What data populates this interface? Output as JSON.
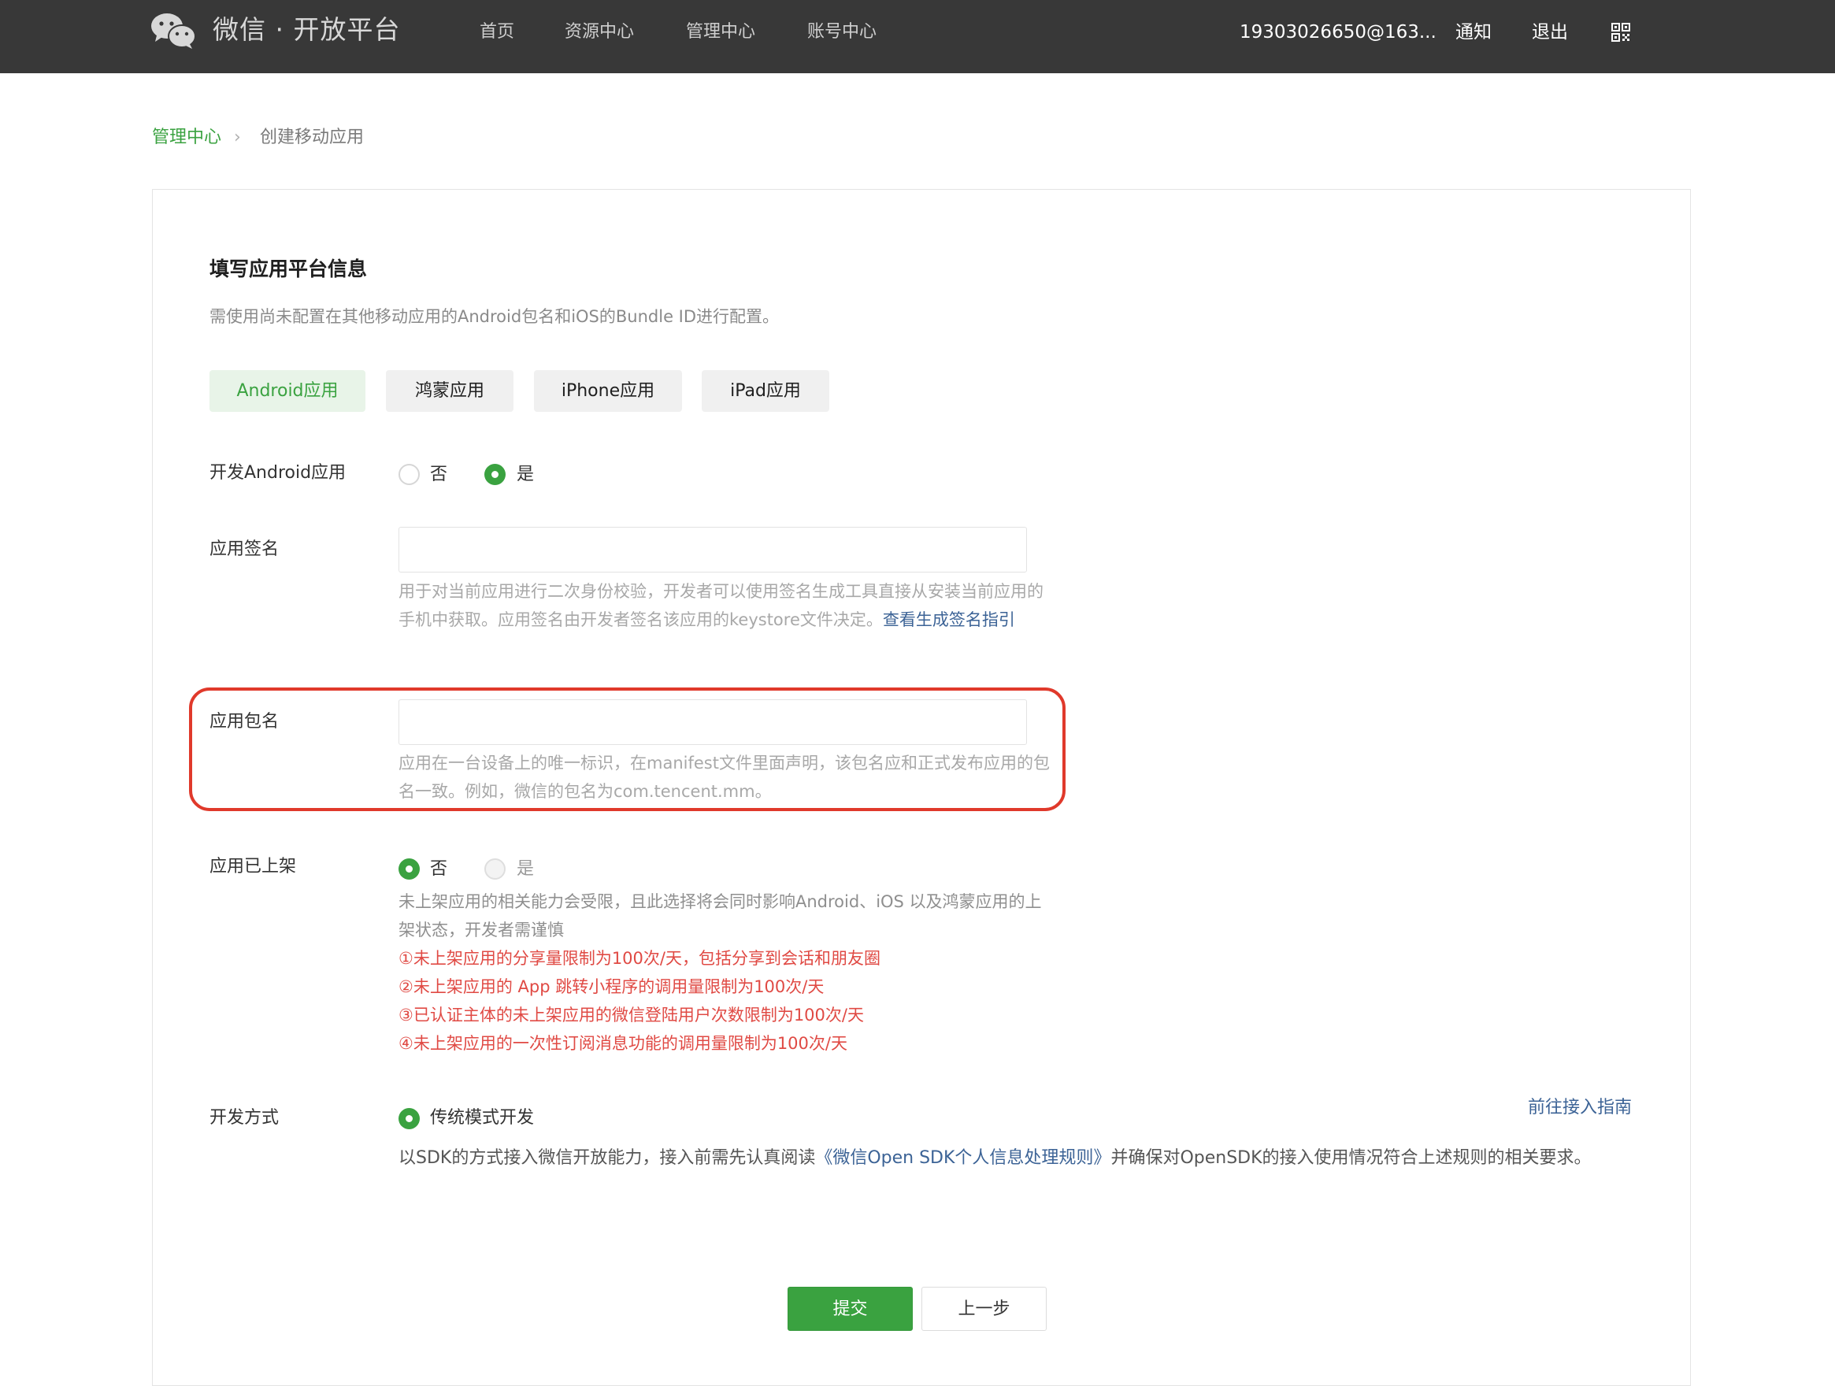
{
  "header": {
    "brand": "微信 · 开放平台",
    "nav": [
      {
        "label": "首页"
      },
      {
        "label": "资源中心"
      },
      {
        "label": "管理中心"
      },
      {
        "label": "账号中心"
      }
    ],
    "account": "19303026650@163...",
    "notify_label": "通知",
    "logout_label": "退出",
    "qr_icon": "qr-code-icon"
  },
  "breadcrumb": {
    "parent": "管理中心",
    "separator": "›",
    "current": "创建移动应用"
  },
  "form": {
    "title": "填写应用平台信息",
    "description": "需使用尚未配置在其他移动应用的Android包名和iOS的Bundle ID进行配置。",
    "tabs": [
      {
        "label": "Android应用",
        "active": true
      },
      {
        "label": "鸿蒙应用",
        "active": false
      },
      {
        "label": "iPhone应用",
        "active": false
      },
      {
        "label": "iPad应用",
        "active": false
      }
    ],
    "develop_android": {
      "label": "开发Android应用",
      "options": [
        "否",
        "是"
      ],
      "selected": "是"
    },
    "app_signature": {
      "label": "应用签名",
      "value": "",
      "help": "用于对当前应用进行二次身份校验，开发者可以使用签名生成工具直接从安装当前应用的手机中获取。应用签名由开发者签名该应用的keystore文件决定。",
      "help_link": "查看生成签名指引"
    },
    "package_name": {
      "label": "应用包名",
      "value": "",
      "help": "应用在一台设备上的唯一标识，在manifest文件里面声明，该包名应和正式发布应用的包名一致。例如，微信的包名为com.tencent.mm。"
    },
    "published": {
      "label": "应用已上架",
      "options": [
        "否",
        "是"
      ],
      "selected": "否",
      "help": "未上架应用的相关能力会受限，且此选择将会同时影响Android、iOS 以及鸿蒙应用的上架状态，开发者需谨慎",
      "warnings": [
        "①未上架应用的分享量限制为100次/天，包括分享到会话和朋友圈",
        "②未上架应用的 App 跳转小程序的调用量限制为100次/天",
        "③已认证主体的未上架应用的微信登陆用户次数限制为100次/天",
        "④未上架应用的一次性订阅消息功能的调用量限制为100次/天"
      ]
    },
    "dev_mode": {
      "label": "开发方式",
      "option": "传统模式开发",
      "guide_link": "前往接入指南",
      "desc_prefix": "以SDK的方式接入微信开放能力，接入前需先认真阅读",
      "desc_link": "《微信Open SDK个人信息处理规则》",
      "desc_suffix": "并确保对OpenSDK的接入使用情况符合上述规则的相关要求。"
    },
    "buttons": {
      "submit": "提交",
      "prev": "上一步"
    }
  },
  "colors": {
    "topbar": "#383838",
    "brand_green": "#3aa240",
    "link_blue": "#3c6396",
    "warning_red": "#e04a44",
    "highlight_red": "#e0392b"
  }
}
